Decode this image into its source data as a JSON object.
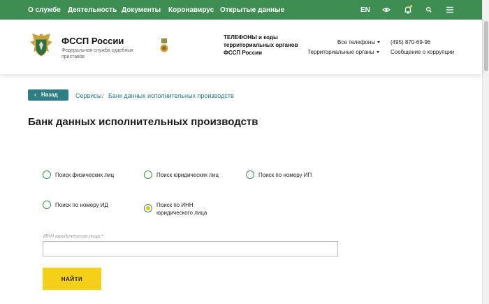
{
  "topnav": {
    "items": [
      "О службе",
      "Деятельность",
      "Документы",
      "Коронавирус",
      "Открытые данные"
    ],
    "lang": "EN",
    "icons": [
      "eye-icon",
      "bell-icon",
      "search-icon",
      "menu-icon"
    ],
    "bg_color": "#3e8e53"
  },
  "header": {
    "org_name": "ФССП России",
    "org_subtitle": "Федеральная служба судебных приставов",
    "phones_title": "ТЕЛЕФОНЫ и коды территориальных органов ФССП России",
    "all_phones": "Все телефоны",
    "territorial": "Территориальные органы",
    "phone": "(495) 870-69-96",
    "corruption": "Сообщение о коррупции"
  },
  "breadcrumb": {
    "back": "Назад",
    "services": "Сервисы",
    "separator": "/",
    "current": "Банк данных исполнительных производств"
  },
  "page_title": "Банк данных исполнительных производств",
  "search_options": [
    {
      "label": "Поиск физических лиц",
      "selected": false
    },
    {
      "label": "Поиск юридических лиц",
      "selected": false
    },
    {
      "label": "Поиск по номеру ИП",
      "selected": false
    },
    {
      "label": "Поиск по номеру ИД",
      "selected": false
    },
    {
      "label_line1": "Поиск по ИНН",
      "label_line2": "юридического лица",
      "selected": true
    }
  ],
  "form": {
    "inn_label": "ИНН юридического лица:*",
    "inn_value": "",
    "submit": "НАЙТИ"
  },
  "colors": {
    "accent_green": "#3e8e53",
    "teal": "#2d7f84",
    "button_yellow": "#f5d018"
  }
}
